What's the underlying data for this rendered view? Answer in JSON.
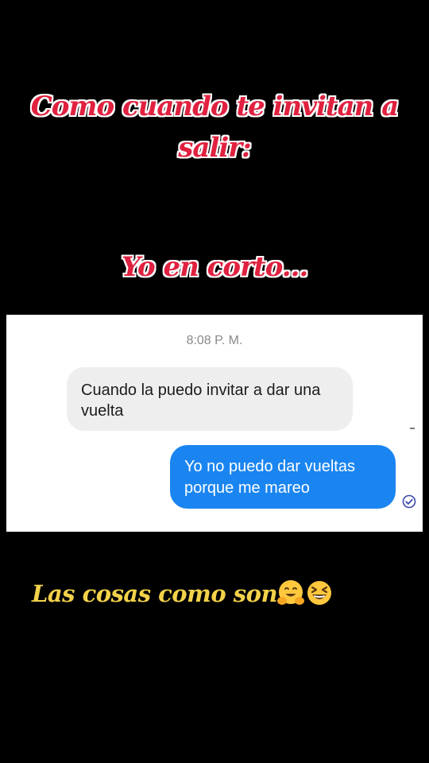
{
  "meme": {
    "title": "Como cuando te invitan a salir:",
    "subtitle": "Yo en corto...",
    "caption": "Las cosas como son",
    "caption_emojis": [
      "hugging-face-emoji",
      "grinning-squinting-face-emoji"
    ]
  },
  "chat": {
    "timestamp": "8:08 P. M.",
    "incoming_message": "Cuando la puedo invitar a dar una vuelta",
    "outgoing_message": "Yo no puedo dar vueltas porque me mareo",
    "read_receipt_icon": "check-circle-icon"
  },
  "colors": {
    "title_red": "#e0213f",
    "caption_yellow": "#f3d24a",
    "outgoing_bubble": "#1a85f0",
    "incoming_bubble": "#eeeeee"
  }
}
